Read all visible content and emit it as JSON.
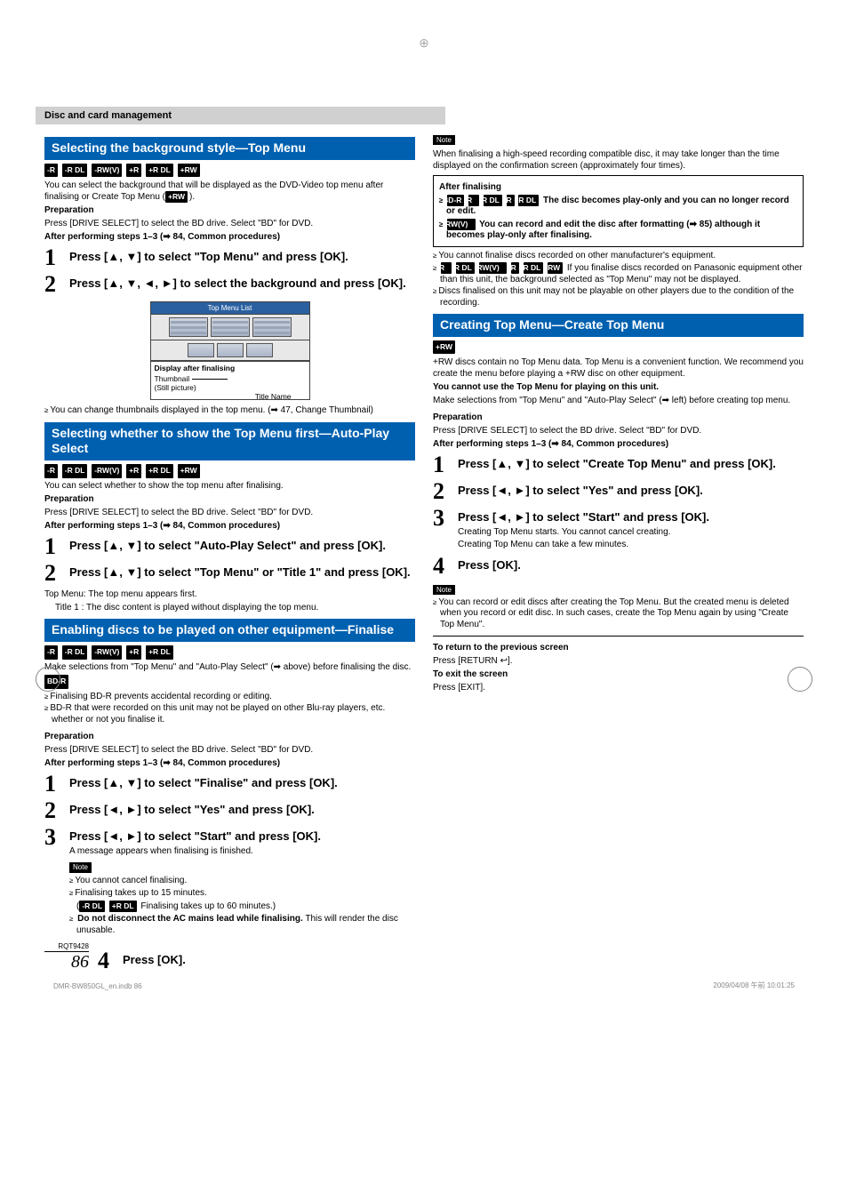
{
  "header": {
    "breadcrumb": "Disc and card management"
  },
  "sec_bgstyle": {
    "title": "Selecting the background style—Top Menu",
    "tags": [
      "-R",
      "-R DL",
      "-RW(V)",
      "+R",
      "+R DL",
      "+RW"
    ],
    "intro1": "You can select the background that will be displayed as the DVD-Video top menu after finalising or Create Top Menu (",
    "intro2": ").",
    "rw_tag": "+RW",
    "prep_label": "Preparation",
    "prep_text": "Press [DRIVE SELECT] to select the BD drive. Select \"BD\" for DVD.",
    "after": "After performing steps 1–3 (➡ 84, Common procedures)",
    "step1": "Press [▲, ▼] to select \"Top Menu\" and press [OK].",
    "step2": "Press [▲, ▼, ◄, ►] to select the background and press [OK].",
    "diagram": {
      "title": "Top Menu List",
      "sub": "Display after finalising",
      "lab1": "Thumbnail",
      "lab2": "(Still picture)",
      "titlename": "Title Name"
    },
    "bullet1": "You can change thumbnails displayed in the top menu. (➡ 47, Change Thumbnail)"
  },
  "sec_autoplay": {
    "title": "Selecting whether to show the Top Menu first—Auto-Play Select",
    "tags": [
      "-R",
      "-R DL",
      "-RW(V)",
      "+R",
      "+R DL",
      "+RW"
    ],
    "intro": "You can select whether to show the top menu after finalising.",
    "prep_label": "Preparation",
    "prep_text": "Press [DRIVE SELECT] to select the BD drive. Select \"BD\" for DVD.",
    "after": "After performing steps 1–3 (➡ 84, Common procedures)",
    "step1": "Press [▲, ▼] to select \"Auto-Play Select\" and press [OK].",
    "step2": "Press [▲, ▼] to select \"Top Menu\" or \"Title 1\" and press [OK].",
    "top_menu_line": "Top Menu: The top menu appears first.",
    "title1_line": "Title 1 : The disc content is played without displaying the top menu."
  },
  "sec_finalise": {
    "title": "Enabling discs to be played on other equipment—Finalise",
    "tags": [
      "-R",
      "-R DL",
      "-RW(V)",
      "+R",
      "+R DL"
    ],
    "intro": "Make selections from \"Top Menu\" and \"Auto-Play Select\" (➡ above) before finalising the disc.",
    "bdr_tag": "BD-R",
    "bdr_b1": "Finalising BD-R prevents accidental recording or editing.",
    "bdr_b2": "BD-R that were recorded on this unit may not be played on other Blu-ray players, etc. whether or not you finalise it.",
    "prep_label": "Preparation",
    "prep_text": "Press [DRIVE SELECT] to select the BD drive. Select \"BD\" for DVD.",
    "after": "After performing steps 1–3 (➡ 84, Common procedures)",
    "step1": "Press [▲, ▼] to select \"Finalise\" and press [OK].",
    "step2": "Press [◄, ►] to select \"Yes\" and press [OK].",
    "step3": "Press [◄, ►] to select \"Start\" and press [OK].",
    "step3_sub": "A message appears when finalising is finished.",
    "note_label": "Note",
    "n1": "You cannot cancel finalising.",
    "n2": "Finalising takes up to 15 minutes.",
    "n3_pre": "(",
    "n3_tags": [
      "-R DL",
      "+R DL"
    ],
    "n3_post": " Finalising takes up to 60 minutes.)",
    "n4a": "Do not disconnect the AC mains lead while finalising.",
    "n4b": "This will render the disc unusable.",
    "step4": "Press [OK]."
  },
  "right_note": {
    "label": "Note",
    "text": "When finalising a high-speed recording compatible disc, it may take longer than the time displayed on the confirmation screen (approximately four times)."
  },
  "after_fin": {
    "title": "After finalising",
    "row1_tags": [
      "BD-R",
      "-R",
      "-R DL",
      "+R",
      "+R DL"
    ],
    "row1_text": " The disc becomes play-only and you can no longer record or edit.",
    "row2_tag": "-RW(V)",
    "row2_text": " You can record and edit the disc after formatting (➡ 85) although it becomes play-only after finalising.",
    "b1": "You cannot finalise discs recorded on other manufacturer's equipment.",
    "b2_tags": [
      "-R",
      "-R DL",
      "-RW(V)",
      "+R",
      "+R DL",
      "+RW"
    ],
    "b2_text": " If you finalise discs recorded on Panasonic equipment other than this unit, the background selected as \"Top Menu\" may not be displayed.",
    "b3": "Discs finalised on this unit may not be playable on other players due to the condition of the recording."
  },
  "sec_create": {
    "title": "Creating Top Menu—Create Top Menu",
    "tag": "+RW",
    "intro": "+RW discs contain no Top Menu data. Top Menu is a convenient function. We recommend you create the menu before playing a +RW disc on other equipment.",
    "cannot": "You cannot use the Top Menu for playing on this unit.",
    "makesel": "Make selections from \"Top Menu\" and \"Auto-Play Select\" (➡ left) before creating top menu.",
    "prep_label": "Preparation",
    "prep_text": "Press [DRIVE SELECT] to select the BD drive. Select \"BD\" for DVD.",
    "after": "After performing steps 1–3 (➡ 84, Common procedures)",
    "step1": "Press [▲, ▼] to select \"Create Top Menu\" and press [OK].",
    "step2": "Press [◄, ►] to select \"Yes\" and press [OK].",
    "step3": "Press [◄, ►] to select \"Start\" and press [OK].",
    "step3_sub1": "Creating Top Menu starts. You cannot cancel creating.",
    "step3_sub2": "Creating Top Menu can take a few minutes.",
    "step4": "Press [OK].",
    "note_label": "Note",
    "note_b1": "You can record or edit discs after creating the Top Menu. But the created menu is deleted when you record or edit disc. In such cases, create the Top Menu again by using \"Create Top Menu\"."
  },
  "nav": {
    "return_label": "To return to the previous screen",
    "return_text": "Press [RETURN ",
    "return_text2": "].",
    "exit_label": "To exit the screen",
    "exit_text": "Press [EXIT]."
  },
  "page": {
    "rqt": "RQT9428",
    "num": "86",
    "foot_left": "DMR-BW850GL_en.indb   86",
    "foot_right": "2009/04/08   午前 10:01:25"
  }
}
